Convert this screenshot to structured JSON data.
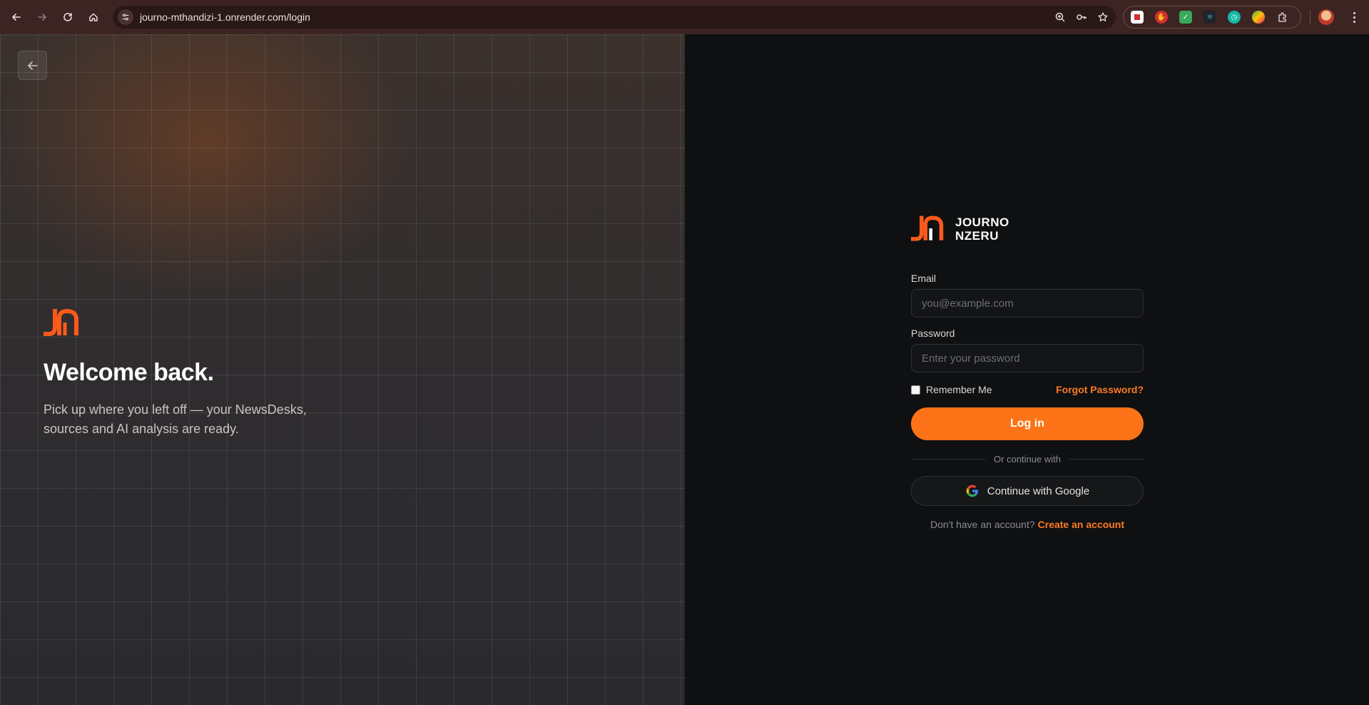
{
  "browser": {
    "url": "journo-mthandizi-1.onrender.com/login"
  },
  "left_panel": {
    "title": "Welcome back.",
    "subtitle": "Pick up where you left off — your NewsDesks, sources and AI analysis are ready."
  },
  "brand": {
    "line1": "JOURNO",
    "line2": "NZERU",
    "accent_color": "#fb5a1a"
  },
  "form": {
    "email_label": "Email",
    "email_placeholder": "you@example.com",
    "email_value": "",
    "password_label": "Password",
    "password_placeholder": "Enter your password",
    "password_value": "",
    "remember_label": "Remember Me",
    "remember_checked": false,
    "forgot_label": "Forgot Password?",
    "login_label": "Log in",
    "divider_text": "Or continue with",
    "google_label": "Continue with Google",
    "signup_prompt": "Don't have an account?",
    "signup_link": "Create an account"
  },
  "colors": {
    "primary": "#fb7316",
    "link": "#fb7a22",
    "background": "#0f1012"
  }
}
